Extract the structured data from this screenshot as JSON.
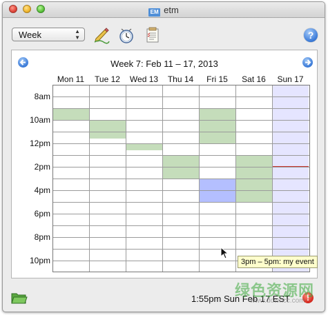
{
  "window": {
    "title": "etm",
    "app_icon_text": "EM"
  },
  "toolbar": {
    "view_select": {
      "value": "Week",
      "arrows": "▲▼"
    },
    "tools": [
      {
        "name": "edit-tool-button",
        "icon": "pen-icon"
      },
      {
        "name": "clock-tool-button",
        "icon": "clock-icon"
      },
      {
        "name": "list-tool-button",
        "icon": "list-icon"
      }
    ],
    "help_label": "?"
  },
  "calendar": {
    "week_title": "Week 7:  Feb 11 – 17, 2013",
    "days": [
      "Mon 11",
      "Tue 12",
      "Wed 13",
      "Thu 14",
      "Fri 15",
      "Sat 16",
      "Sun 17"
    ],
    "today_index": 6,
    "hour_labels": [
      "8am",
      "10am",
      "12pm",
      "2pm",
      "4pm",
      "6pm",
      "8pm",
      "10pm"
    ],
    "events": [
      {
        "day": 0,
        "start": "9:00",
        "end": "10:00"
      },
      {
        "day": 1,
        "start": "10:00",
        "end": "11:30"
      },
      {
        "day": 2,
        "start": "12:00",
        "end": "12:30"
      },
      {
        "day": 3,
        "start": "13:00",
        "end": "15:00"
      },
      {
        "day": 4,
        "start": "9:00",
        "end": "12:00"
      },
      {
        "day": 4,
        "start": "15:00",
        "end": "17:00",
        "selected": true
      },
      {
        "day": 5,
        "start": "13:00",
        "end": "17:00"
      }
    ],
    "now_marker": {
      "day": 6,
      "time": "13:55"
    },
    "tooltip": "3pm – 5pm: my event",
    "colors": {
      "event": "#c5ddbb",
      "selected_event": "#b4bfff",
      "today_column": "#e5e5ff",
      "now_line": "#c8342c"
    }
  },
  "status": {
    "time_text": "1:55pm Sun Feb 17 EST",
    "alert_label": "!"
  },
  "watermark": {
    "text_cn": "绿色资源网",
    "url": "www.downcc.com"
  }
}
